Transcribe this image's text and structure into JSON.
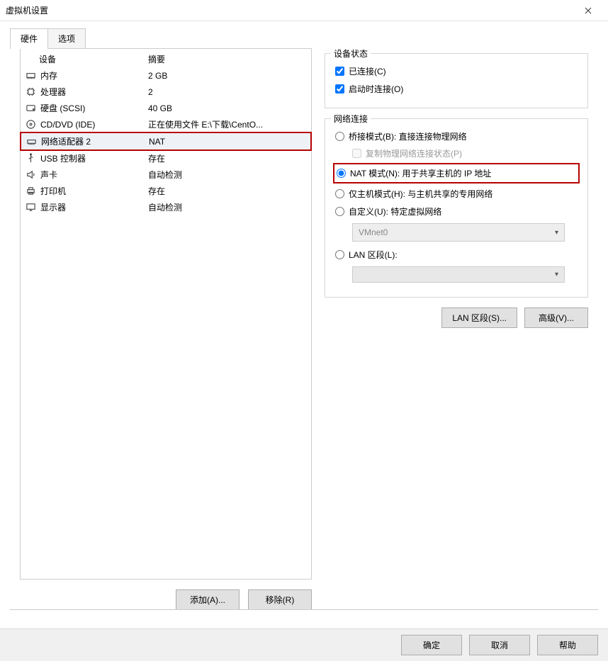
{
  "window": {
    "title": "虚拟机设置"
  },
  "tabs": {
    "hardware": "硬件",
    "options": "选项"
  },
  "list": {
    "header_device": "设备",
    "header_summary": "摘要",
    "rows": [
      {
        "icon": "memory",
        "name": "内存",
        "summary": "2 GB"
      },
      {
        "icon": "cpu",
        "name": "处理器",
        "summary": "2"
      },
      {
        "icon": "hdd",
        "name": "硬盘 (SCSI)",
        "summary": "40 GB"
      },
      {
        "icon": "cd",
        "name": "CD/DVD (IDE)",
        "summary": "正在使用文件 E:\\下载\\CentO..."
      },
      {
        "icon": "net",
        "name": "网络适配器 2",
        "summary": "NAT"
      },
      {
        "icon": "usb",
        "name": "USB 控制器",
        "summary": "存在"
      },
      {
        "icon": "sound",
        "name": "声卡",
        "summary": "自动检测"
      },
      {
        "icon": "printer",
        "name": "打印机",
        "summary": "存在"
      },
      {
        "icon": "display",
        "name": "显示器",
        "summary": "自动检测"
      }
    ],
    "btn_add": "添加(A)...",
    "btn_remove": "移除(R)"
  },
  "device_status": {
    "legend": "设备状态",
    "connected": "已连接(C)",
    "connect_at_poweron": "启动时连接(O)"
  },
  "net_conn": {
    "legend": "网络连接",
    "bridged": "桥接模式(B): 直接连接物理网络",
    "replicate": "复制物理网络连接状态(P)",
    "nat": "NAT 模式(N): 用于共享主机的 IP 地址",
    "hostonly": "仅主机模式(H): 与主机共享的专用网络",
    "custom": "自定义(U): 特定虚拟网络",
    "custom_value": "VMnet0",
    "lan": "LAN 区段(L):",
    "lan_value": ""
  },
  "right_buttons": {
    "lan_segments": "LAN 区段(S)...",
    "advanced": "高级(V)..."
  },
  "footer": {
    "ok": "确定",
    "cancel": "取消",
    "help": "帮助"
  }
}
